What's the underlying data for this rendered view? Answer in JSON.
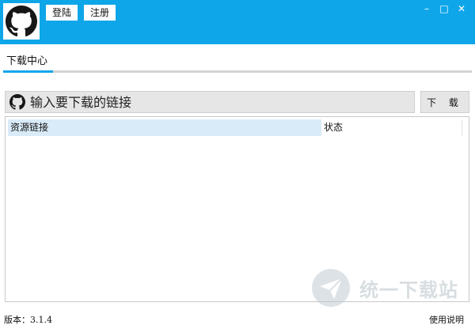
{
  "header": {
    "login_label": "登陆",
    "register_label": "注册",
    "minimize": "–",
    "maximize": "□",
    "close": "✕",
    "brand_color": "#0fa6e9"
  },
  "tabs": [
    {
      "label": "下载中心",
      "active": true
    }
  ],
  "search": {
    "placeholder": "输入要下载的链接",
    "value": ""
  },
  "download_button": "下 载",
  "table": {
    "columns": [
      "资源链接",
      "状态"
    ],
    "rows": []
  },
  "footer": {
    "version": "版本：3.1.4",
    "help": "使用说明"
  },
  "watermark": "统一下载站",
  "icons": {
    "logo": "github-octocat-icon",
    "search_prefix": "github-icon"
  }
}
